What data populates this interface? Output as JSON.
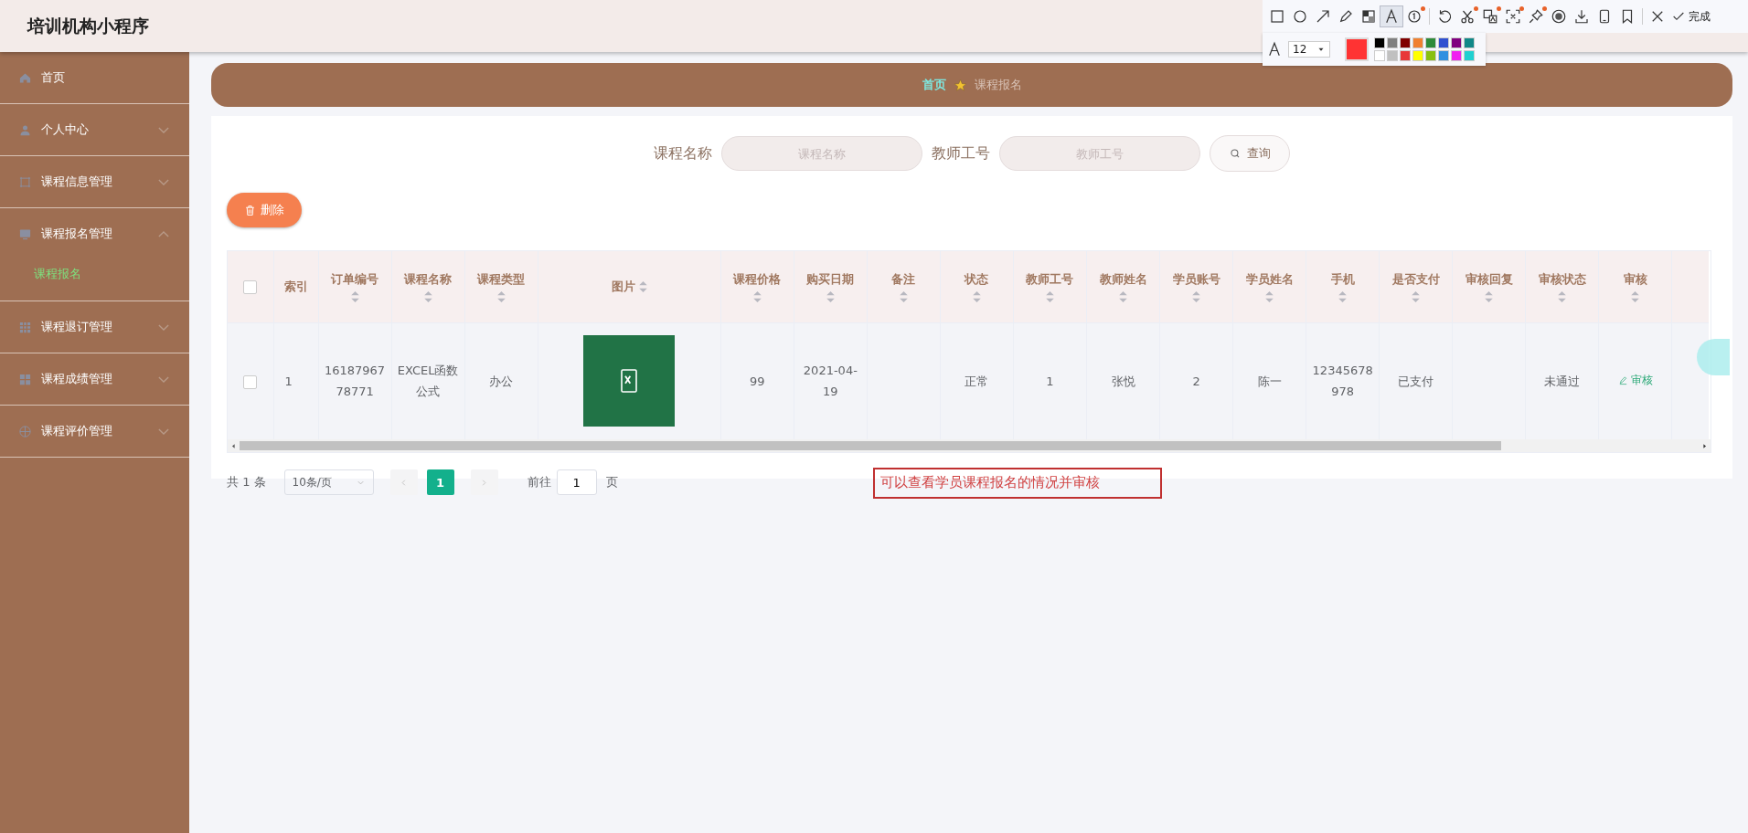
{
  "header": {
    "title": "培训机构小程序"
  },
  "capture_toolbar": {
    "tools": [
      {
        "kind": "rect",
        "selected": false,
        "badge": false
      },
      {
        "kind": "circle",
        "selected": false,
        "badge": false
      },
      {
        "kind": "arrow",
        "selected": false,
        "badge": false
      },
      {
        "kind": "pencil",
        "selected": false,
        "badge": false
      },
      {
        "kind": "mosaic",
        "selected": false,
        "badge": false
      },
      {
        "kind": "text",
        "selected": true,
        "badge": false
      },
      {
        "kind": "number",
        "selected": false,
        "badge": true
      },
      {
        "kind": "sep"
      },
      {
        "kind": "undo",
        "selected": false,
        "badge": false
      },
      {
        "kind": "scissors",
        "selected": false,
        "badge": true
      },
      {
        "kind": "translate",
        "selected": false,
        "badge": true
      },
      {
        "kind": "frame",
        "selected": false,
        "badge": true
      },
      {
        "kind": "pin",
        "selected": false,
        "badge": true
      },
      {
        "kind": "record",
        "selected": false,
        "badge": false
      },
      {
        "kind": "download",
        "selected": false,
        "badge": false
      },
      {
        "kind": "phone",
        "selected": false,
        "badge": false
      },
      {
        "kind": "bookmark",
        "selected": false,
        "badge": false
      },
      {
        "kind": "sep"
      },
      {
        "kind": "close",
        "selected": false,
        "badge": false
      }
    ],
    "done_label": "完成",
    "font_size": "12",
    "swatches": [
      {
        "color": "#000000"
      },
      {
        "color": "#808080"
      },
      {
        "color": "#800000"
      },
      {
        "color": "#f08030"
      },
      {
        "color": "#2e8b3a"
      },
      {
        "color": "#3050d0"
      },
      {
        "color": "#800080"
      },
      {
        "color": "#108888"
      },
      {
        "color": "#ffffff"
      },
      {
        "color": "#c0c0c0"
      },
      {
        "color": "#e83838"
      },
      {
        "color": "#ffff00"
      },
      {
        "color": "#88c010"
      },
      {
        "color": "#3090e0"
      },
      {
        "color": "#f020f0"
      },
      {
        "color": "#20d0d0"
      }
    ]
  },
  "sidebar": {
    "items": [
      {
        "label": "首页",
        "has_arrow": false
      },
      {
        "label": "个人中心",
        "has_arrow": true,
        "expanded": false
      },
      {
        "label": "课程信息管理",
        "has_arrow": true,
        "expanded": false
      },
      {
        "label": "课程报名管理",
        "has_arrow": true,
        "expanded": true,
        "children": [
          {
            "label": "课程报名",
            "selected": true
          }
        ]
      },
      {
        "label": "课程退订管理",
        "has_arrow": true,
        "expanded": false
      },
      {
        "label": "课程成绩管理",
        "has_arrow": true,
        "expanded": false
      },
      {
        "label": "课程评价管理",
        "has_arrow": true,
        "expanded": false
      }
    ]
  },
  "breadcrumb": [
    "首页",
    "课程报名"
  ],
  "search": {
    "fields": [
      {
        "label": "课程名称",
        "placeholder": "课程名称"
      },
      {
        "label": "教师工号",
        "placeholder": "教师工号"
      }
    ],
    "button": "查询"
  },
  "delete_button": "删除",
  "table": {
    "header_checked": false,
    "columns": [
      {
        "kind": "check"
      },
      {
        "label": "索引",
        "sortable": false
      },
      {
        "label": "订单编号",
        "sortable": true
      },
      {
        "label": "课程名称",
        "sortable": true
      },
      {
        "label": "课程类型",
        "sortable": true
      },
      {
        "label": "图片",
        "sortable": true,
        "kind": "image"
      },
      {
        "label": "课程价格",
        "sortable": true
      },
      {
        "label": "购买日期",
        "sortable": true
      },
      {
        "label": "备注",
        "sortable": true
      },
      {
        "label": "状态",
        "sortable": true
      },
      {
        "label": "教师工号",
        "sortable": true
      },
      {
        "label": "教师姓名",
        "sortable": true
      },
      {
        "label": "学员账号",
        "sortable": true
      },
      {
        "label": "学员姓名",
        "sortable": true
      },
      {
        "label": "手机",
        "sortable": true
      },
      {
        "label": "是否支付",
        "sortable": true
      },
      {
        "label": "审核回复",
        "sortable": true
      },
      {
        "label": "审核状态",
        "sortable": true
      },
      {
        "label": "审核",
        "sortable": true
      }
    ],
    "rows": [
      {
        "checked": false,
        "cells": [
          "",
          "1",
          "1618796778771",
          "EXCEL函数公式",
          "办公",
          "",
          "99",
          "2021-04-19",
          "",
          "正常",
          "1",
          "张悦",
          "2",
          "陈一",
          "12345678978",
          "已支付",
          "",
          "未通过",
          "审核"
        ]
      }
    ]
  },
  "pagination": {
    "total": "共 1 条",
    "page_size": "10条/页",
    "pages": [
      {
        "label": "1",
        "selected": true
      }
    ],
    "goto_label": "前往",
    "goto_value": "1",
    "page_unit": "页"
  },
  "annotation": {
    "text": "可以查看学员课程报名的情况并审核"
  }
}
